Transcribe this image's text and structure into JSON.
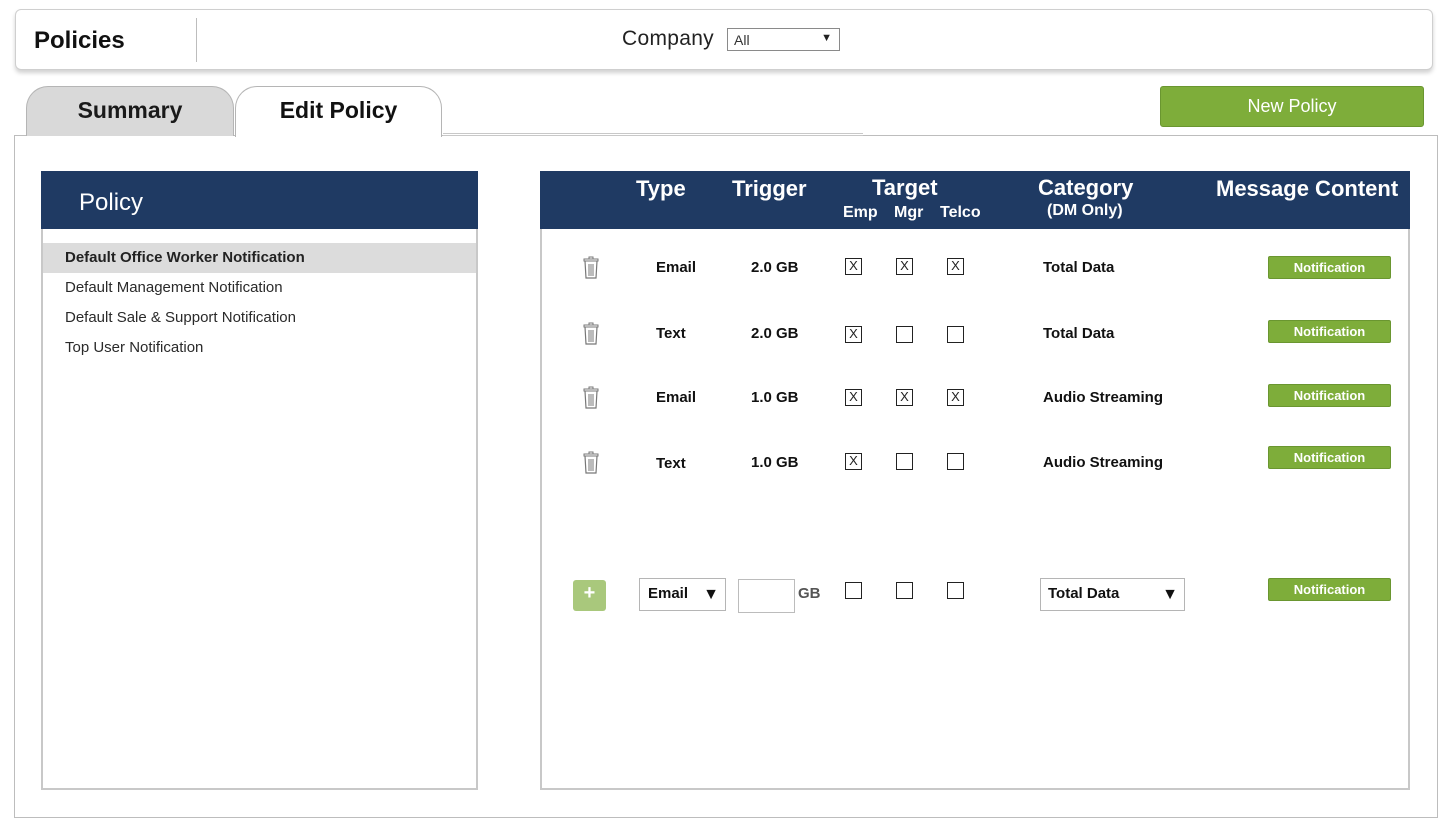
{
  "header": {
    "title": "Policies",
    "company_label": "Company",
    "company_value": "All"
  },
  "tabs": [
    {
      "label": "Summary",
      "active": false
    },
    {
      "label": "Edit Policy",
      "active": true
    }
  ],
  "new_policy_label": "New Policy",
  "policy_panel": {
    "title": "Policy",
    "items": [
      {
        "label": "Default Office Worker Notification",
        "selected": true
      },
      {
        "label": "Default Management Notification",
        "selected": false
      },
      {
        "label": "Default Sale & Support Notification",
        "selected": false
      },
      {
        "label": "Top User Notification",
        "selected": false
      }
    ]
  },
  "rules_header": {
    "type": "Type",
    "trigger": "Trigger",
    "target": "Target",
    "emp": "Emp",
    "mgr": "Mgr",
    "telco": "Telco",
    "category": "Category",
    "category_note": "(DM Only)",
    "message": "Message Content"
  },
  "rules": [
    {
      "type": "Email",
      "trigger": "2.0 GB",
      "emp": true,
      "mgr": true,
      "telco": true,
      "category": "Total Data",
      "message": "Notification"
    },
    {
      "type": "Text",
      "trigger": "2.0 GB",
      "emp": true,
      "mgr": false,
      "telco": false,
      "category": "Total Data",
      "message": "Notification"
    },
    {
      "type": "Email",
      "trigger": "1.0 GB",
      "emp": true,
      "mgr": true,
      "telco": true,
      "category": "Audio Streaming",
      "message": "Notification"
    },
    {
      "type": "Text",
      "trigger": "1.0 GB",
      "emp": true,
      "mgr": false,
      "telco": false,
      "category": "Audio Streaming",
      "message": "Notification"
    }
  ],
  "new_rule": {
    "add_label": "+",
    "type_value": "Email",
    "trigger_value": "",
    "trigger_unit": "GB",
    "emp": false,
    "mgr": false,
    "telco": false,
    "category_value": "Total Data",
    "message": "Notification"
  },
  "icons": {
    "trash": "trash-icon",
    "dropdown": "triangle-down-icon",
    "check_mark": "X"
  },
  "colors": {
    "header_navy": "#1f3a63",
    "button_green": "#7ead3a",
    "add_green": "#a9c87c"
  }
}
